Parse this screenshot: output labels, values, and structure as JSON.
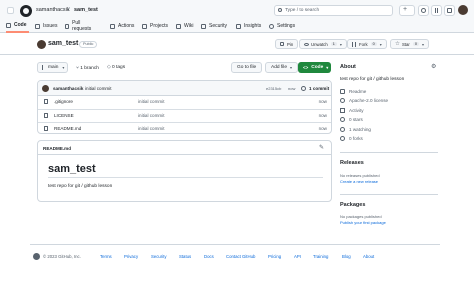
{
  "header": {
    "owner": "samanthacsik",
    "separator": "/",
    "repo": "sam_test",
    "search_placeholder": "Type / to search"
  },
  "tabs": [
    {
      "label": "Code",
      "icon": "code-icon"
    },
    {
      "label": "Issues",
      "icon": "issue-icon"
    },
    {
      "label": "Pull requests",
      "icon": "pull-request-icon"
    },
    {
      "label": "Actions",
      "icon": "play-icon"
    },
    {
      "label": "Projects",
      "icon": "table-icon"
    },
    {
      "label": "Wiki",
      "icon": "book-icon"
    },
    {
      "label": "Security",
      "icon": "shield-icon"
    },
    {
      "label": "Insights",
      "icon": "graph-icon"
    },
    {
      "label": "Settings",
      "icon": "gear-icon"
    }
  ],
  "repo_header": {
    "name": "sam_test",
    "visibility": "Public",
    "pin_label": "Pin",
    "watch_label": "Unwatch",
    "watch_count": "1",
    "fork_label": "Fork",
    "fork_count": "0",
    "star_label": "Star",
    "star_count": "0"
  },
  "branch_bar": {
    "branch": "main",
    "branches": "1 branch",
    "tags": "0 tags",
    "goto_label": "Go to file",
    "add_file_label": "Add file",
    "code_label": "Code"
  },
  "latest_commit": {
    "author": "samanthacsik",
    "message": "initial commit",
    "hash": "e2315cb",
    "when": "now",
    "count": "1 commit"
  },
  "files": [
    {
      "name": ".gitignore",
      "message": "initial commit",
      "time": "now"
    },
    {
      "name": "LICENSE",
      "message": "initial commit",
      "time": "now"
    },
    {
      "name": "README.md",
      "message": "initial commit",
      "time": "now"
    }
  ],
  "readme": {
    "file_label": "README.md",
    "title": "sam_test",
    "body": "test repo for git / github lesson"
  },
  "about": {
    "title": "About",
    "description": "test repo for git / github lesson",
    "items": [
      "Readme",
      "Apache-2.0 license",
      "Activity",
      "0 stars",
      "1 watching",
      "0 forks"
    ]
  },
  "releases": {
    "title": "Releases",
    "none_text": "No releases published",
    "link": "Create a new release"
  },
  "packages": {
    "title": "Packages",
    "none_text": "No packages published",
    "link": "Publish your first package"
  },
  "footer": {
    "copyright": "© 2023 GitHub, Inc.",
    "links": [
      "Terms",
      "Privacy",
      "Security",
      "Status",
      "Docs",
      "Contact GitHub",
      "Pricing",
      "API",
      "Training",
      "Blog",
      "About"
    ]
  },
  "colors": {
    "accent_tab": "#fd8c73",
    "code_button": "#1f883d",
    "link": "#0969da"
  }
}
